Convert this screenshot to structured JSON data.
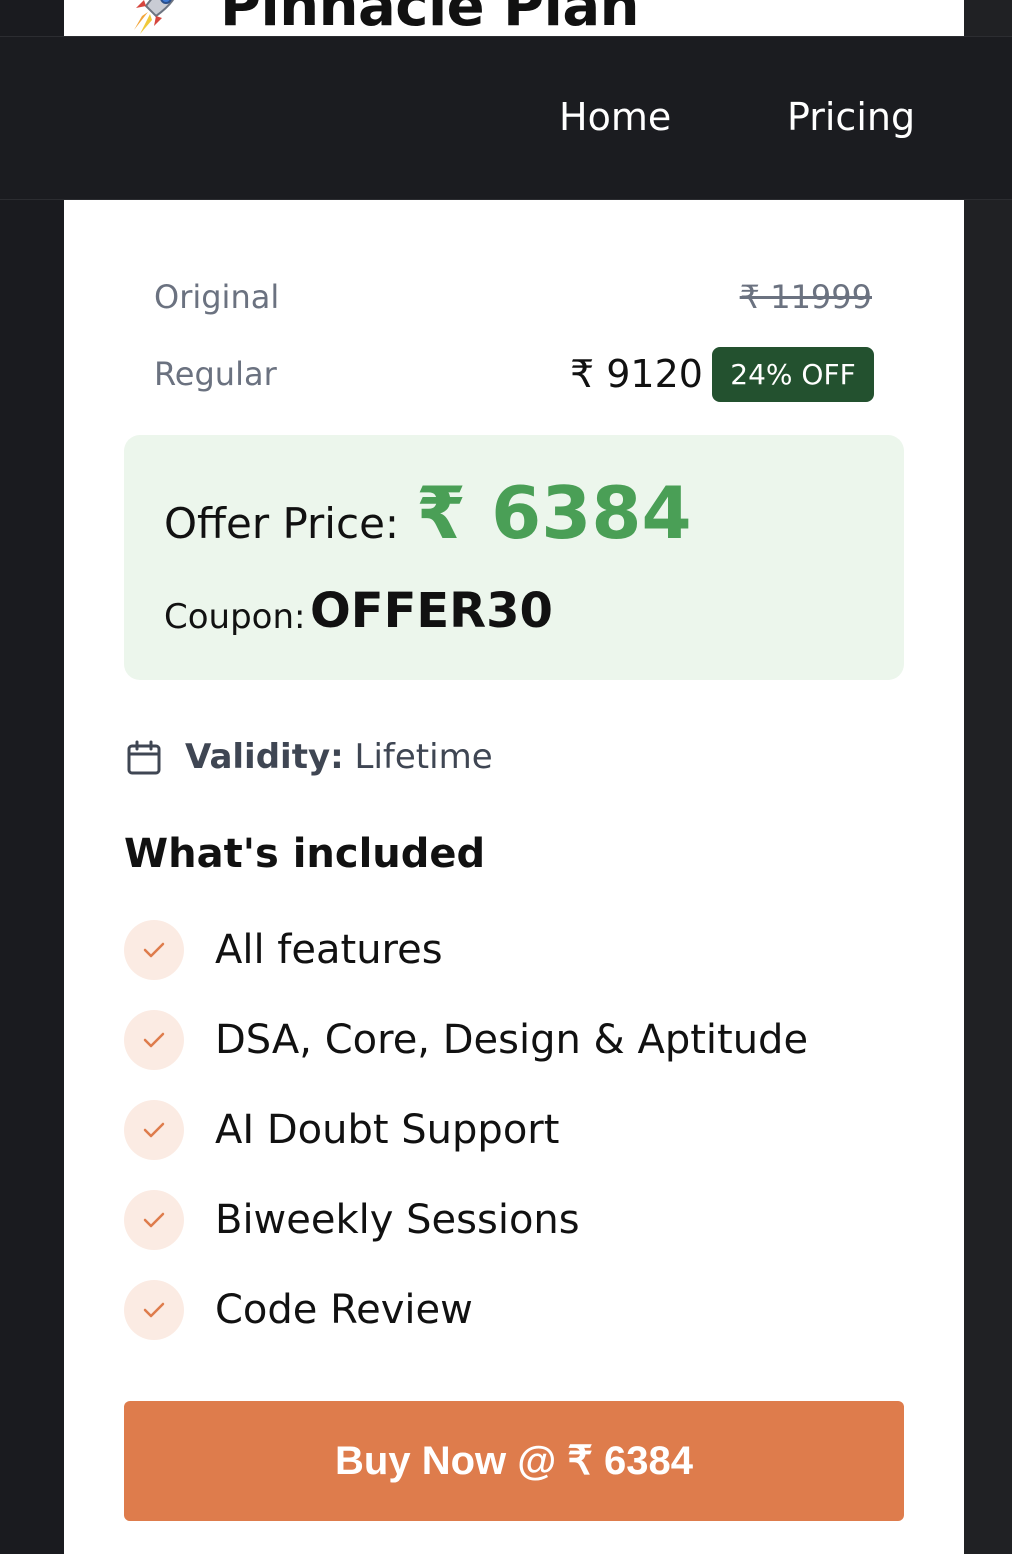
{
  "header": {
    "plan_name": "Pinnacle Plan",
    "icon": "rocket-icon"
  },
  "nav": {
    "home": "Home",
    "pricing": "Pricing"
  },
  "pricing": {
    "original_label": "Original",
    "original_price": "₹ 11999",
    "regular_label": "Regular",
    "regular_price": "₹ 9120",
    "discount_badge": "24% OFF"
  },
  "offer": {
    "label": "Offer Price:",
    "price": "₹ 6384",
    "coupon_label": "Coupon:",
    "coupon_code": "OFFER30"
  },
  "validity": {
    "icon": "calendar-icon",
    "label": "Validity:",
    "value": "Lifetime"
  },
  "included": {
    "title": "What's included",
    "items": [
      "All features",
      "DSA, Core, Design & Aptitude",
      "AI Doubt Support",
      "Biweekly Sessions",
      "Code Review"
    ]
  },
  "cta": {
    "label": "Buy Now @ ₹ 6384"
  },
  "colors": {
    "accent": "#de7c4c",
    "offer_green": "#4a9f56",
    "badge_green": "#23512f",
    "nav_bg": "#1b1c20"
  }
}
